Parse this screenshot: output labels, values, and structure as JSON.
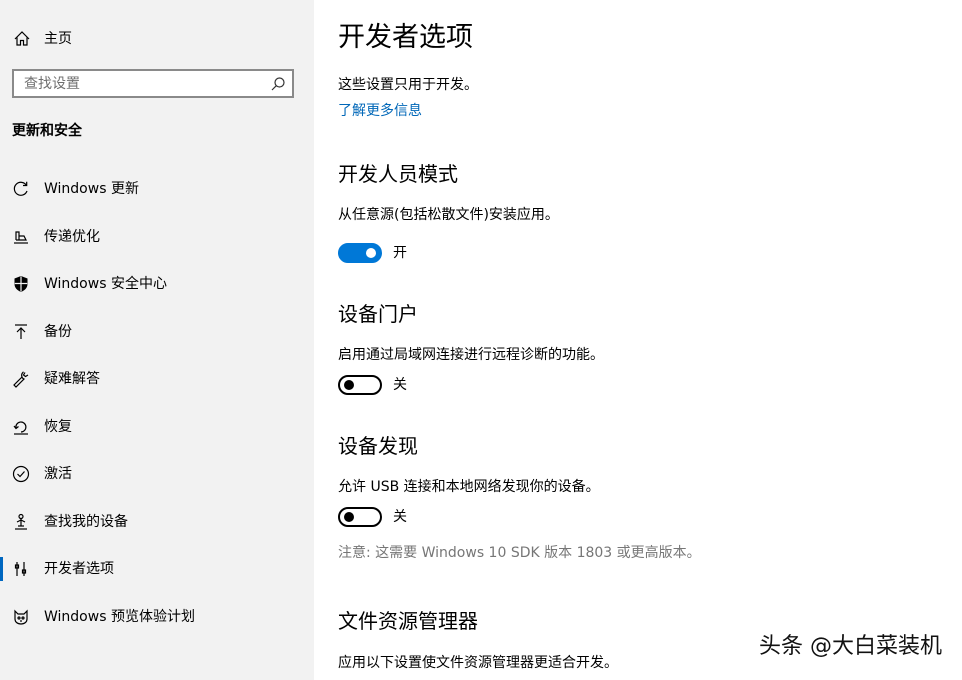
{
  "sidebar": {
    "home_label": "主页",
    "search": {
      "placeholder": "查找设置"
    },
    "section_title": "更新和安全",
    "items": [
      {
        "label": "Windows 更新",
        "icon": "refresh-icon"
      },
      {
        "label": "传递优化",
        "icon": "delivery-optimization-icon"
      },
      {
        "label": "Windows 安全中心",
        "icon": "shield-icon"
      },
      {
        "label": "备份",
        "icon": "backup-arrow-icon"
      },
      {
        "label": "疑难解答",
        "icon": "wrench-icon"
      },
      {
        "label": "恢复",
        "icon": "recovery-icon"
      },
      {
        "label": "激活",
        "icon": "check-circle-icon"
      },
      {
        "label": "查找我的设备",
        "icon": "find-device-icon"
      },
      {
        "label": "开发者选项",
        "icon": "developer-icon",
        "active": true
      },
      {
        "label": "Windows 预览体验计划",
        "icon": "insider-cat-icon"
      }
    ]
  },
  "main": {
    "title": "开发者选项",
    "intro": "这些设置只用于开发。",
    "learn_more": "了解更多信息",
    "developer_mode": {
      "title": "开发人员模式",
      "description": "从任意源(包括松散文件)安装应用。",
      "toggle_state": "on",
      "toggle_label": "开"
    },
    "device_portal": {
      "title": "设备门户",
      "description": "启用通过局域网连接进行远程诊断的功能。",
      "toggle_state": "off",
      "toggle_label": "关"
    },
    "device_discovery": {
      "title": "设备发现",
      "description": "允许 USB 连接和本地网络发现你的设备。",
      "toggle_state": "off",
      "toggle_label": "关",
      "note": "注意: 这需要 Windows 10 SDK 版本 1803 或更高版本。"
    },
    "file_explorer": {
      "title": "文件资源管理器",
      "description": "应用以下设置使文件资源管理器更适合开发。"
    }
  },
  "watermark": "头条 @大白菜装机",
  "colors": {
    "accent": "#0078d7",
    "link": "#0067b8",
    "sidebar_bg": "#f2f2f2",
    "note": "#767676"
  }
}
